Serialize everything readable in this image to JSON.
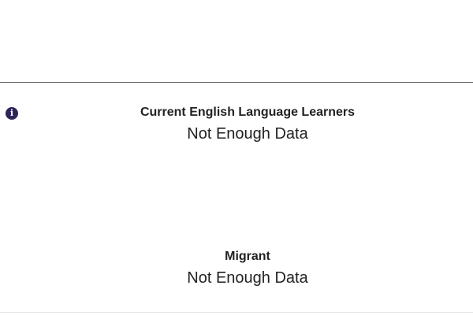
{
  "metrics": [
    {
      "label": "Current English Language Learners",
      "value": "Not Enough Data",
      "info_icon": "info-icon"
    },
    {
      "label": "Migrant",
      "value": "Not Enough Data"
    }
  ],
  "colors": {
    "info_icon_bg": "#2d2659",
    "text": "#222222",
    "divider": "#5a5a5a"
  },
  "icons": {
    "info_glyph": "i"
  }
}
